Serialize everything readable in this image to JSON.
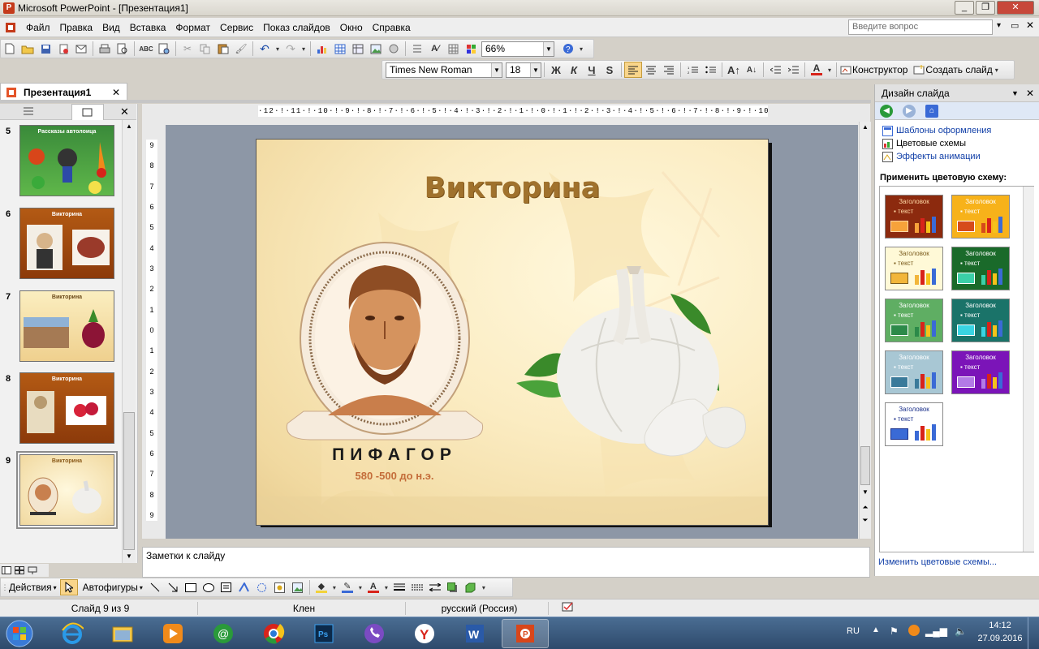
{
  "window": {
    "title": "Microsoft PowerPoint - [Презентация1]",
    "minimize": "_",
    "restore": "❐",
    "close": "✕"
  },
  "menu": {
    "items": [
      "Файл",
      "Правка",
      "Вид",
      "Вставка",
      "Формат",
      "Сервис",
      "Показ слайдов",
      "Окно",
      "Справка"
    ],
    "help_placeholder": "Введите вопрос"
  },
  "standard_toolbar": {
    "zoom": "66%"
  },
  "format_toolbar": {
    "font": "Times New Roman",
    "size": "18",
    "bold": "Ж",
    "italic": "К",
    "underline": "Ч",
    "shadow": "S",
    "designer": "Конструктор",
    "new_slide": "Создать слайд"
  },
  "document_tab": {
    "name": "Презентация1",
    "close": "✕"
  },
  "slides_pane": {
    "close": "✕",
    "thumbnails": [
      {
        "number": "5",
        "title": "Рассказы автолоица"
      },
      {
        "number": "6",
        "title": "Викторина"
      },
      {
        "number": "7",
        "title": "Викторина"
      },
      {
        "number": "8",
        "title": "Викторина"
      },
      {
        "number": "9",
        "title": "Викторина"
      }
    ],
    "selected": "9"
  },
  "ruler": {
    "horizontal": "·12·!·11·!·10·!·9·!·8·!·7·!·6·!·5·!·4·!·3·!·2·!·1·!·0·!·1·!·2·!·3·!·4·!·5·!·6·!·7·!·8·!·9·!·10·!·11·!·12·",
    "vertical": [
      "9",
      "8",
      "7",
      "6",
      "5",
      "4",
      "3",
      "2",
      "1",
      "0",
      "1",
      "2",
      "3",
      "4",
      "5",
      "6",
      "7",
      "8",
      "9"
    ]
  },
  "slide": {
    "title": "Викторина",
    "person_name": "ПИФАГОР",
    "person_dates": "580 -500 до н.э."
  },
  "notes": {
    "placeholder": "Заметки к слайду"
  },
  "task_pane": {
    "title": "Дизайн слайда",
    "links": [
      "Шаблоны оформления",
      "Цветовые схемы",
      "Эффекты анимации"
    ],
    "apply_label": "Применить цветовую схему:",
    "schemes": [
      {
        "heading": "Заголовок",
        "text": "текст",
        "bg": "#8c2a0e",
        "fg": "#ffd9a6",
        "accent": "#f7a23a"
      },
      {
        "heading": "Заголовок",
        "text": "текст",
        "bg": "#f7b21a",
        "fg": "#ffffff",
        "accent": "#d64b1a"
      },
      {
        "heading": "Заголовок",
        "text": "текст",
        "bg": "#fff9d7",
        "fg": "#7a5b1c",
        "accent": "#f2b63a"
      },
      {
        "heading": "Заголовок",
        "text": "текст",
        "bg": "#1a6a2a",
        "fg": "#ffffff",
        "accent": "#3bd0a8"
      },
      {
        "heading": "Заголовок",
        "text": "текст",
        "bg": "#5fae63",
        "fg": "#ffffff",
        "accent": "#2c8a49"
      },
      {
        "heading": "Заголовок",
        "text": "текст",
        "bg": "#1a7369",
        "fg": "#ffffff",
        "accent": "#39d4e2"
      },
      {
        "heading": "Заголовок",
        "text": "текст",
        "bg": "#a8c7d4",
        "fg": "#ffffff",
        "accent": "#3a7a9a"
      },
      {
        "heading": "Заголовок",
        "text": "текст",
        "bg": "#7b14b8",
        "fg": "#ffffff",
        "accent": "#b37ae6"
      },
      {
        "heading": "Заголовок",
        "text": "текст",
        "bg": "#ffffff",
        "fg": "#1a2f8a",
        "accent": "#3a6ad6"
      }
    ],
    "change_link": "Изменить цветовые схемы..."
  },
  "drawing_toolbar": {
    "actions": "Действия",
    "autoshapes": "Автофигуры"
  },
  "status": {
    "slide": "Слайд 9 из 9",
    "design": "Клен",
    "language": "русский (Россия)"
  },
  "taskbar": {
    "lang": "RU",
    "time": "14:12",
    "date": "27.09.2016"
  }
}
